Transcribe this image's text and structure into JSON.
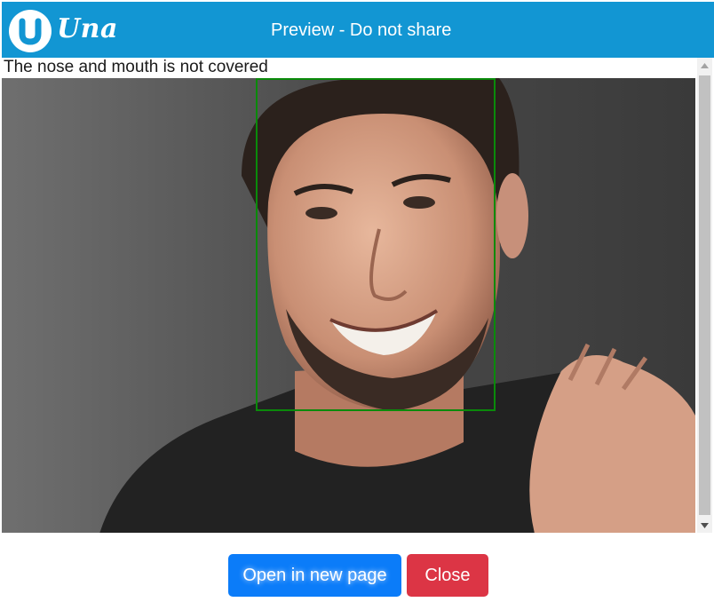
{
  "header": {
    "logo_text": "Una",
    "title": "Preview - Do not share"
  },
  "content": {
    "caption": "The nose and mouth is not covered",
    "photo_alt": "Preview photo with detected face box"
  },
  "buttons": {
    "open_label": "Open in new page",
    "close_label": "Close"
  },
  "colors": {
    "header_bg": "#1296d3",
    "open_button": "#0b7cf9",
    "close_button": "#dc3545",
    "face_box": "#0a8a0a"
  }
}
